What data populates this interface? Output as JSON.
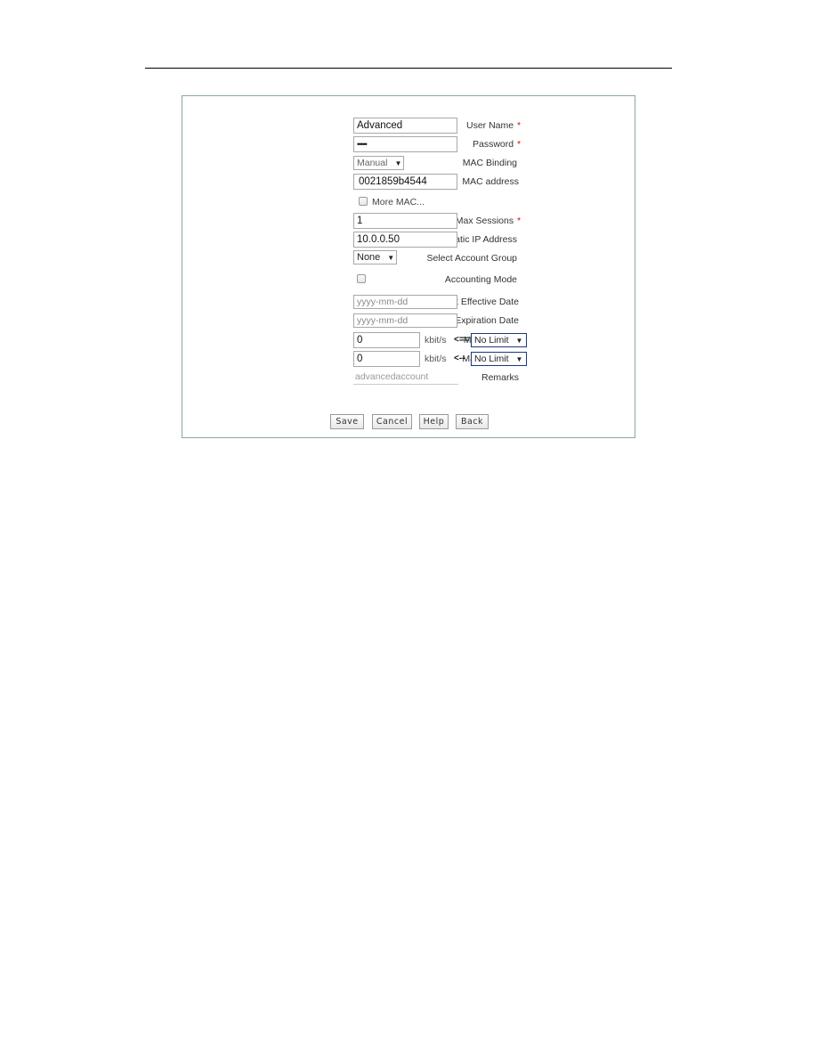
{
  "form": {
    "user_name": {
      "label": "User Name",
      "required_mark": "*",
      "value": "Advanced"
    },
    "password": {
      "label": "Password",
      "required_mark": "*",
      "value": "•••••"
    },
    "mac_binding": {
      "label": "MAC Binding",
      "selected": "Manual",
      "arrow": "▼"
    },
    "mac_address": {
      "label": "MAC address",
      "value": "0021859b4544"
    },
    "more_mac": {
      "label": "More MAC...",
      "checked": false
    },
    "max_sessions": {
      "label": "Max Sessions",
      "required_mark": "*",
      "value": "1"
    },
    "static_ip": {
      "label": "Static IP Address",
      "value": "10.0.0.50"
    },
    "account_group": {
      "label": "Select Account Group",
      "selected": "None",
      "arrow": "▼"
    },
    "accounting_mode": {
      "label": "Accounting Mode",
      "checked": false
    },
    "effective_date": {
      "label": "Account Effective Date",
      "placeholder": "yyyy-mm-dd"
    },
    "expiration_date": {
      "label": "Account Expiration Date",
      "placeholder": "yyyy-mm-dd"
    },
    "tx_rate": {
      "label": "Max. Tx Rate",
      "value": "0",
      "unit": "kbit/s",
      "arrow": "<==",
      "selected": "No Limit",
      "dropdown_arrow": "▼"
    },
    "rx_rate": {
      "label": "Max. Rx Rate",
      "value": "0",
      "unit": "kbit/s",
      "arrow": "<--",
      "selected": "No Limit",
      "dropdown_arrow": "▼"
    },
    "remarks": {
      "label": "Remarks",
      "value": "advancedaccount"
    }
  },
  "buttons": {
    "save": "Save",
    "cancel": "Cancel",
    "help": "Help",
    "back": "Back"
  }
}
